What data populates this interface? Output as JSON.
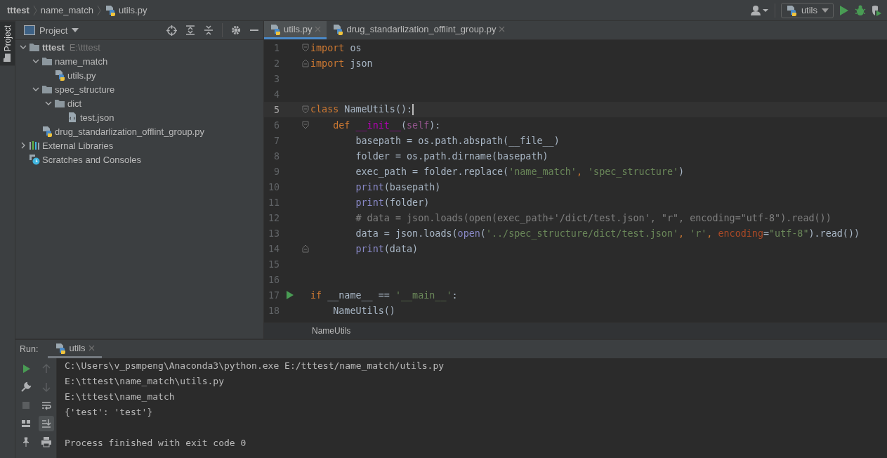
{
  "navigation_bar": {
    "breadcrumbs": [
      {
        "label": "tttest",
        "kind": "project"
      },
      {
        "label": "name_match",
        "kind": "folder"
      },
      {
        "label": "utils.py",
        "kind": "python"
      }
    ],
    "run_configuration": "utils"
  },
  "side_tab": {
    "label": "Project",
    "selected": true
  },
  "project_panel": {
    "title": "Project",
    "tree": [
      {
        "label": "tttest",
        "hint": "E:\\tttest",
        "kind": "folder",
        "expanded": true,
        "children": [
          {
            "label": "name_match",
            "kind": "folder",
            "expanded": true,
            "children": [
              {
                "label": "utils.py",
                "kind": "python"
              }
            ]
          },
          {
            "label": "spec_structure",
            "kind": "folder",
            "expanded": true,
            "children": [
              {
                "label": "dict",
                "kind": "folder",
                "expanded": true,
                "children": [
                  {
                    "label": "test.json",
                    "kind": "json"
                  }
                ]
              }
            ]
          },
          {
            "label": "drug_standarlization_offlint_group.py",
            "kind": "python"
          }
        ]
      },
      {
        "label": "External Libraries",
        "kind": "libraries",
        "expanded": false
      },
      {
        "label": "Scratches and Consoles",
        "kind": "scratches"
      }
    ]
  },
  "editor": {
    "tabs": [
      {
        "label": "utils.py",
        "selected": true
      },
      {
        "label": "drug_standarlization_offlint_group.py",
        "selected": false
      }
    ],
    "lines": [
      {
        "number": "1",
        "current": false,
        "kind": "fold-start",
        "text": "import os"
      },
      {
        "number": "2",
        "current": false,
        "kind": "fold-end",
        "text": "import json"
      },
      {
        "number": "3",
        "current": false,
        "kind": "plain"
      },
      {
        "number": "4",
        "current": false,
        "kind": "plain"
      },
      {
        "number": "5",
        "current": true,
        "kind": "fold-start",
        "text": "class NameUtils():"
      },
      {
        "number": "6",
        "current": false,
        "kind": "fold-start",
        "text": "    def __init__(self):"
      },
      {
        "number": "7",
        "current": false,
        "kind": "plain",
        "text": "        basepath = os.path.abspath(__file__)"
      },
      {
        "number": "8",
        "current": false,
        "kind": "plain",
        "text": "        folder = os.path.dirname(basepath)"
      },
      {
        "number": "9",
        "current": false,
        "kind": "plain",
        "text": "        exec_path = folder.replace('name_match', 'spec_structure')"
      },
      {
        "number": "10",
        "current": false,
        "kind": "plain",
        "text": "        print(basepath)"
      },
      {
        "number": "11",
        "current": false,
        "kind": "plain",
        "text": "        print(folder)"
      },
      {
        "number": "12",
        "current": false,
        "kind": "plain",
        "text": "        # data = json.loads(open(exec_path+'/dict/test.json', \"r\", encoding=\"utf-8\").read())"
      },
      {
        "number": "13",
        "current": false,
        "kind": "plain",
        "text": "        data = json.loads(open('../spec_structure/dict/test.json', 'r', encoding=\"utf-8\").read())"
      },
      {
        "number": "14",
        "current": false,
        "kind": "fold-end",
        "text": "        print(data)"
      },
      {
        "number": "15",
        "current": false,
        "kind": "plain"
      },
      {
        "number": "16",
        "current": false,
        "kind": "plain"
      },
      {
        "number": "17",
        "current": false,
        "kind": "run",
        "text": "if __name__ == '__main__':"
      },
      {
        "number": "18",
        "current": false,
        "kind": "plain",
        "text": "    NameUtils()"
      }
    ],
    "breadcrumb": "NameUtils"
  },
  "run_panel": {
    "title": "Run:",
    "tab": {
      "label": "utils",
      "selected": true
    },
    "tools": [
      {
        "kind": "run",
        "disabled": false,
        "selected": false
      },
      {
        "kind": "up",
        "disabled": true,
        "selected": false
      },
      {
        "kind": "wrench",
        "disabled": false,
        "selected": false
      },
      {
        "kind": "down",
        "disabled": true,
        "selected": false
      },
      {
        "kind": "stop",
        "disabled": true,
        "selected": false
      },
      {
        "kind": "wrap",
        "disabled": false,
        "selected": false
      },
      {
        "kind": "layout",
        "disabled": false,
        "selected": false
      },
      {
        "kind": "scrollend",
        "disabled": false,
        "selected": true
      },
      {
        "kind": "pin",
        "disabled": false,
        "selected": false
      },
      {
        "kind": "print",
        "disabled": false,
        "selected": false
      }
    ],
    "output": [
      {
        "kind": "line",
        "text": "C:\\Users\\v_psmpeng\\Anaconda3\\python.exe E:/tttest/name_match/utils.py"
      },
      {
        "kind": "line",
        "text": "E:\\tttest\\name_match\\utils.py"
      },
      {
        "kind": "line",
        "text": "E:\\tttest\\name_match"
      },
      {
        "kind": "line",
        "text": "{'test': 'test'}"
      },
      {
        "kind": "blank"
      },
      {
        "kind": "line",
        "text": "Process finished with exit code 0"
      }
    ]
  }
}
